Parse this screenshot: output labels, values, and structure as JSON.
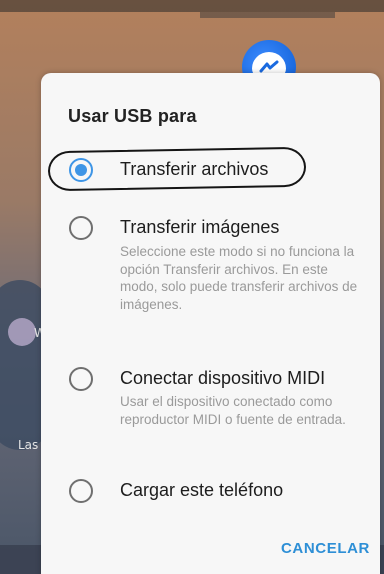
{
  "dialog": {
    "title": "Usar USB para",
    "options": [
      {
        "label": "Transferir archivos",
        "description": "",
        "selected": true
      },
      {
        "label": "Transferir imágenes",
        "description": "Seleccione este modo si no funciona la opción Transferir archivos. En este modo, solo puede transferir archivos de imágenes.",
        "selected": false
      },
      {
        "label": "Conectar dispositivo MIDI",
        "description": "Usar el dispositivo conectado como reproductor MIDI o fuente de entrada.",
        "selected": false
      },
      {
        "label": "Cargar este teléfono",
        "description": "",
        "selected": false
      }
    ],
    "cancel_label": "CANCELAR"
  },
  "background": {
    "left_text_1": "W",
    "left_text_2": "Las",
    "app_icon": "messenger-icon"
  },
  "colors": {
    "accent": "#3e95e6",
    "cancel": "#2e8fd6",
    "dialog_bg": "#f7f7f7"
  }
}
